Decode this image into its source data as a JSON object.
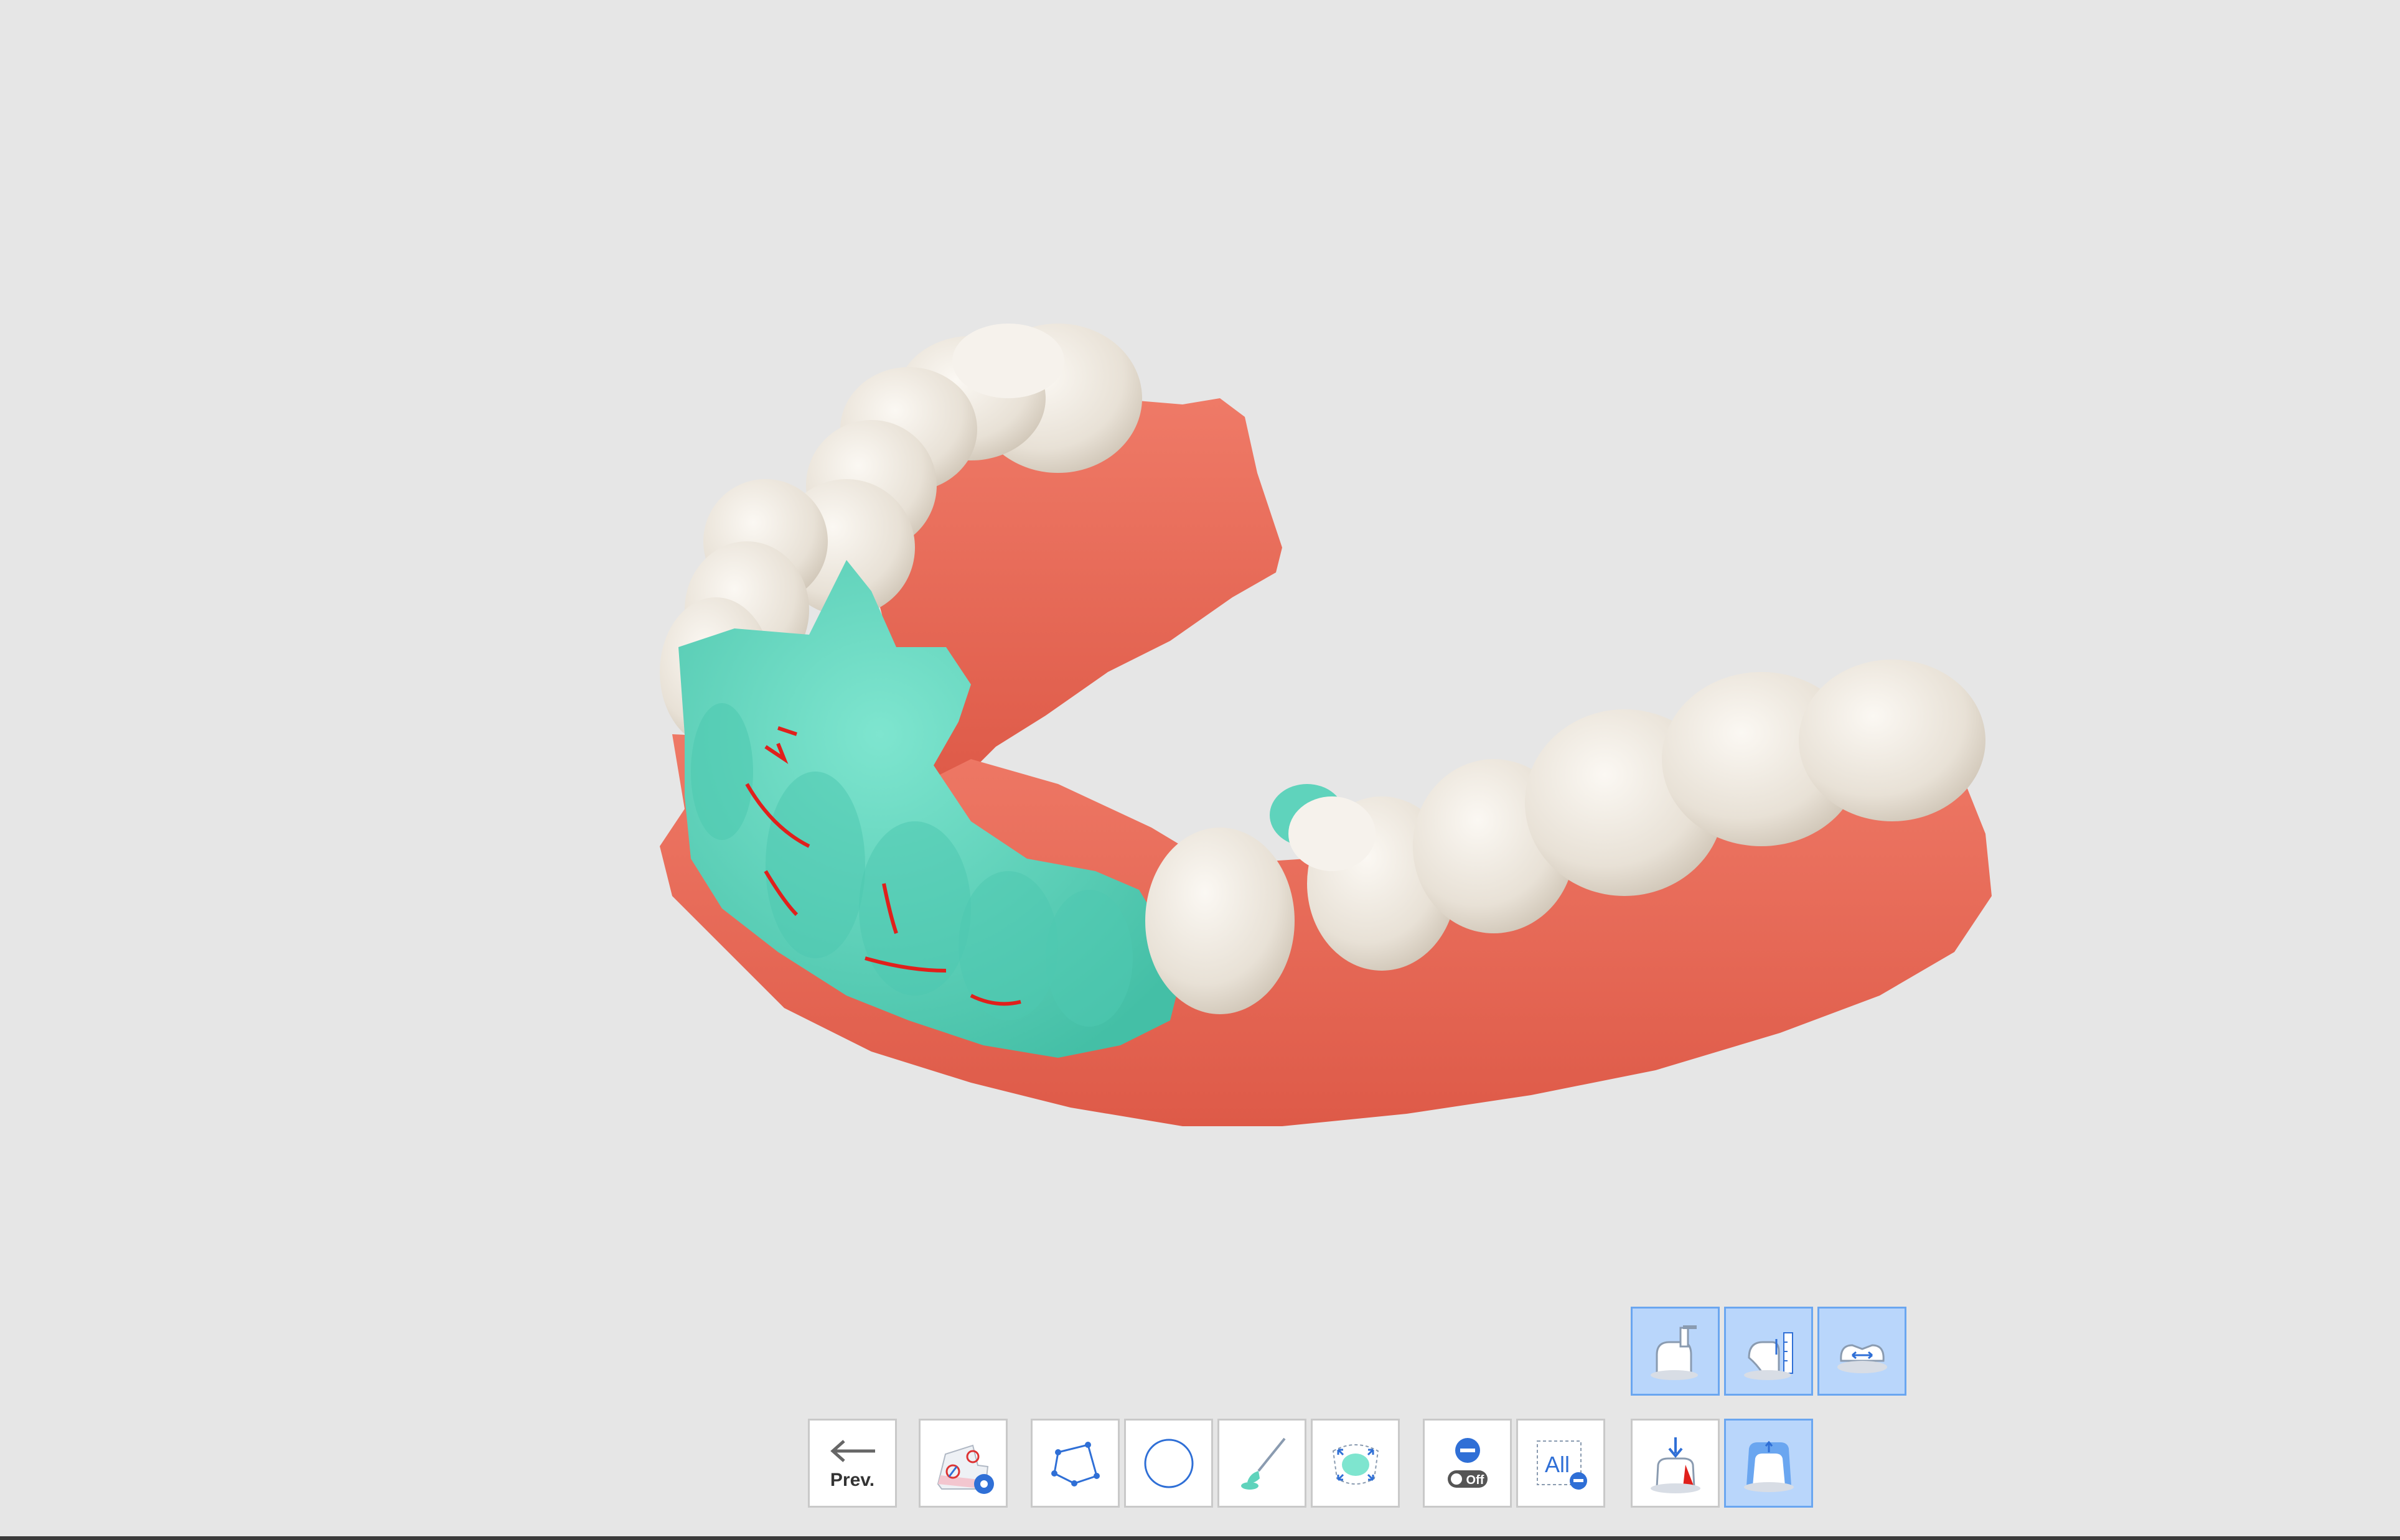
{
  "app": {
    "background_color": "#e6e6e6",
    "tooth_color": "#ece6dd",
    "gum_color": "#ea6b59",
    "selection_color": "#5fd3bc",
    "margin_line_color": "#e0201c",
    "accent_color": "#2f6fd6",
    "active_button_color": "#b9d6fb"
  },
  "toolbar": {
    "prev_label": "Prev.",
    "all_label": "All",
    "off_label": "Off",
    "buttons": [
      {
        "name": "prev-button",
        "icon": "arrow-left-icon",
        "active": false
      },
      {
        "name": "settings-button",
        "icon": "scan-settings-icon",
        "active": false
      },
      {
        "name": "polyline-select-button",
        "icon": "polygon-icon",
        "active": false
      },
      {
        "name": "circle-select-button",
        "icon": "circle-icon",
        "active": false
      },
      {
        "name": "brush-select-button",
        "icon": "brush-icon",
        "active": false
      },
      {
        "name": "expand-select-button",
        "icon": "expand-selection-icon",
        "active": false
      },
      {
        "name": "deselect-toggle-button",
        "icon": "minus-off-icon",
        "active": false
      },
      {
        "name": "deselect-all-button",
        "icon": "all-minus-icon",
        "active": false
      },
      {
        "name": "insertion-direction-button",
        "icon": "insertion-direction-icon",
        "active": false
      },
      {
        "name": "offset-button",
        "icon": "offset-icon",
        "active": true
      }
    ],
    "sub_buttons": [
      {
        "name": "block-out-button",
        "icon": "block-out-icon",
        "active": true
      },
      {
        "name": "height-adjust-button",
        "icon": "height-adjust-icon",
        "active": false
      },
      {
        "name": "width-adjust-button",
        "icon": "width-adjust-icon",
        "active": false
      }
    ]
  }
}
